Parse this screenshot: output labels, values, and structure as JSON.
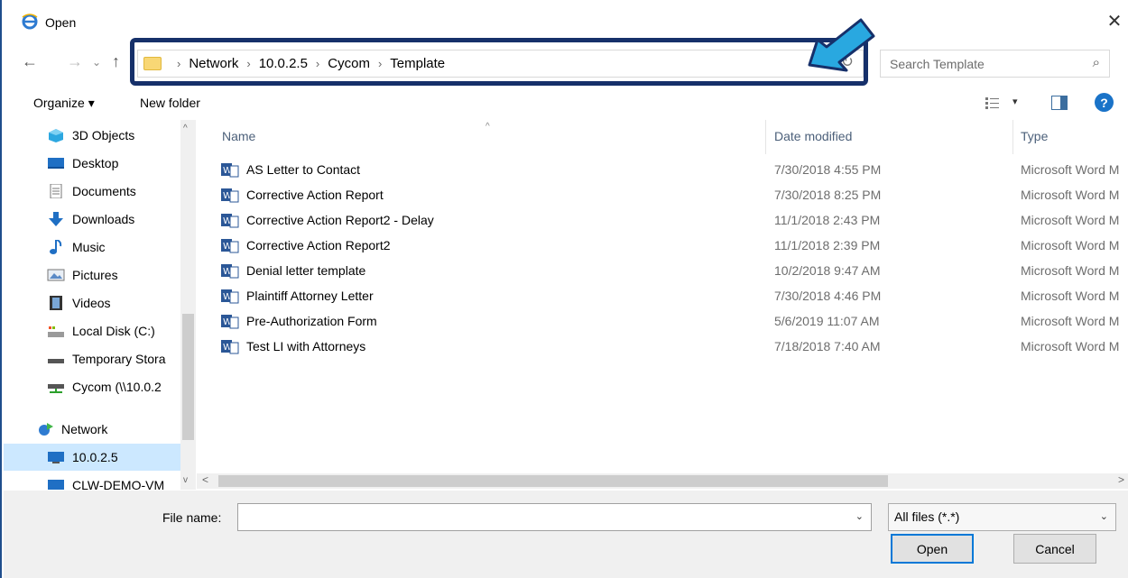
{
  "window": {
    "title": "Open",
    "close_glyph": "✕"
  },
  "nav": {
    "back_glyph": "←",
    "forward_glyph": "→",
    "recent_glyph": "⌄",
    "up_glyph": "↑",
    "refresh_glyph": "↻"
  },
  "address": {
    "breadcrumbs": [
      "Network",
      "10.0.2.5",
      "Cycom",
      "Template"
    ],
    "separator": "›",
    "dropdown_glyph": "⌄"
  },
  "search": {
    "placeholder": "Search Template",
    "icon": "search-icon",
    "glyph": "⌕"
  },
  "toolbar": {
    "organize_label": "Organize ▾",
    "new_folder_label": "New folder",
    "view_chev": "▾",
    "help": "?"
  },
  "sidebar": {
    "items": [
      {
        "label": "3D Objects",
        "icon": "3d-objects-icon"
      },
      {
        "label": "Desktop",
        "icon": "desktop-icon"
      },
      {
        "label": "Documents",
        "icon": "documents-icon"
      },
      {
        "label": "Downloads",
        "icon": "downloads-icon"
      },
      {
        "label": "Music",
        "icon": "music-icon"
      },
      {
        "label": "Pictures",
        "icon": "pictures-icon"
      },
      {
        "label": "Videos",
        "icon": "videos-icon"
      },
      {
        "label": "Local Disk (C:)",
        "icon": "local-disk-icon"
      },
      {
        "label": "Temporary Stora",
        "icon": "drive-icon"
      },
      {
        "label": "Cycom (\\\\10.0.2",
        "icon": "network-drive-icon"
      },
      {
        "label": "Network",
        "icon": "network-icon"
      },
      {
        "label": "10.0.2.5",
        "icon": "computer-icon",
        "selected": true
      },
      {
        "label": "CLW-DEMO-VM",
        "icon": "computer-icon"
      }
    ],
    "scroll_up": "^",
    "scroll_down": "v"
  },
  "columns": {
    "name": "Name",
    "date": "Date modified",
    "type": "Type",
    "sort_glyph": "^"
  },
  "files": [
    {
      "name": "AS Letter to Contact",
      "date": "7/30/2018 4:55 PM",
      "type": "Microsoft Word M"
    },
    {
      "name": "Corrective Action Report",
      "date": "7/30/2018 8:25 PM",
      "type": "Microsoft Word M"
    },
    {
      "name": "Corrective Action Report2 - Delay",
      "date": "11/1/2018 2:43 PM",
      "type": "Microsoft Word M"
    },
    {
      "name": "Corrective Action Report2",
      "date": "11/1/2018 2:39 PM",
      "type": "Microsoft Word M"
    },
    {
      "name": "Denial letter template",
      "date": "10/2/2018 9:47 AM",
      "type": "Microsoft Word M"
    },
    {
      "name": "Plaintiff Attorney Letter",
      "date": "7/30/2018 4:46 PM",
      "type": "Microsoft Word M"
    },
    {
      "name": "Pre-Authorization Form",
      "date": "5/6/2019 11:07 AM",
      "type": "Microsoft Word M"
    },
    {
      "name": "Test LI with Attorneys",
      "date": "7/18/2018 7:40 AM",
      "type": "Microsoft Word M"
    }
  ],
  "hscroll": {
    "left": "<",
    "right": ">"
  },
  "bottom": {
    "file_name_label": "File name:",
    "file_name_value": "",
    "filter_value": "All files (*.*)",
    "chev": "⌄",
    "open_label": "Open",
    "cancel_label": "Cancel"
  },
  "colors": {
    "accent": "#0078d7",
    "highlight_border": "#16306a",
    "arrow_fill": "#29a8e0",
    "selected_bg": "#cce8ff"
  }
}
